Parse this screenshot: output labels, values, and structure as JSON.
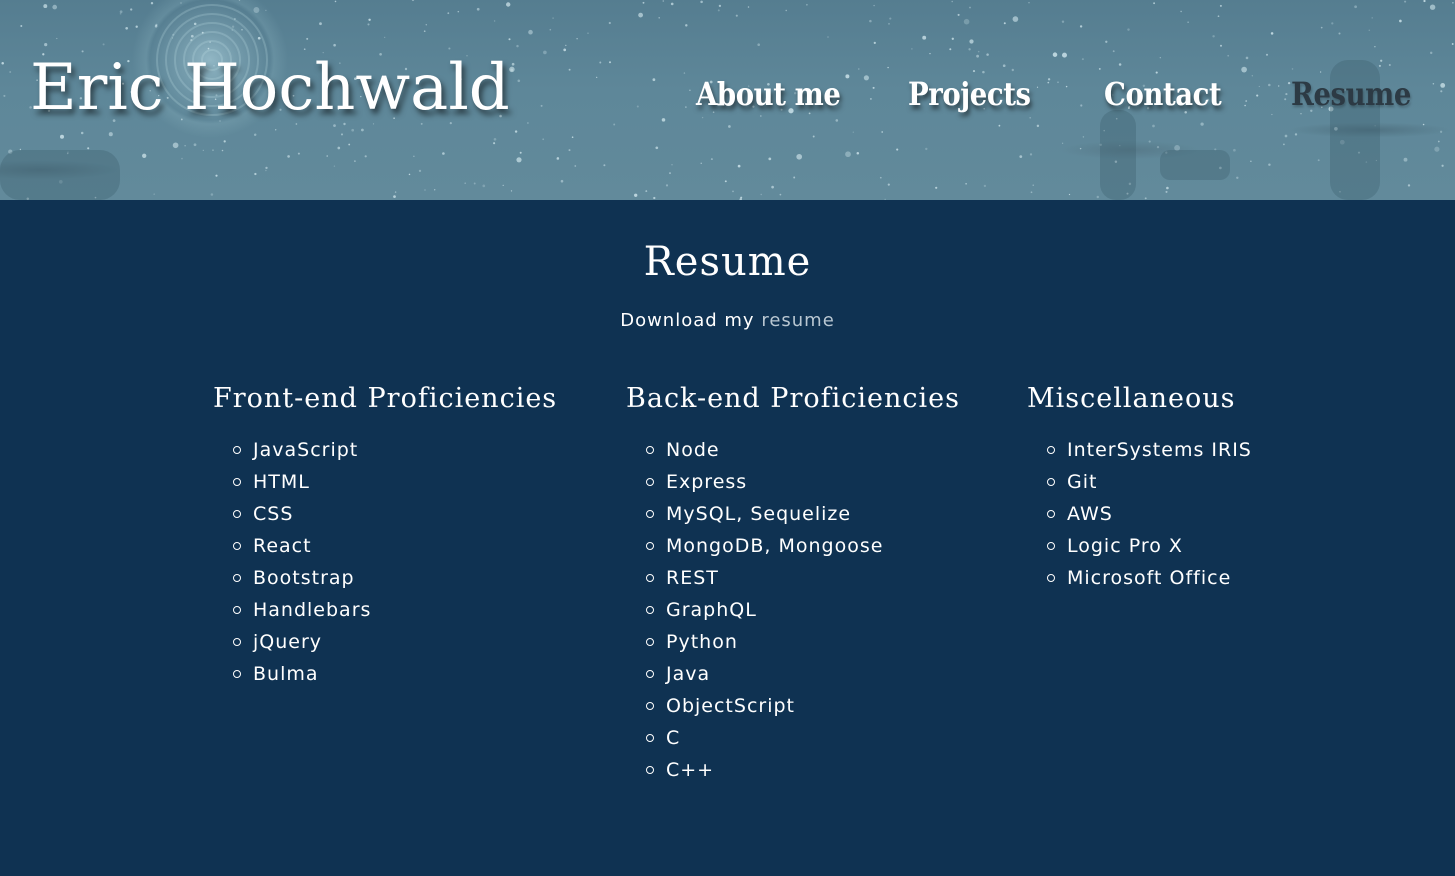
{
  "header": {
    "site_title": "Eric Hochwald",
    "nav": [
      {
        "label": "About me",
        "active": false
      },
      {
        "label": "Projects",
        "active": false
      },
      {
        "label": "Contact",
        "active": false
      },
      {
        "label": "Resume",
        "active": true
      }
    ]
  },
  "main": {
    "title": "Resume",
    "download_prefix": "Download my ",
    "download_link": "resume",
    "columns": [
      {
        "heading": "Front-end Proficiencies",
        "items": [
          "JavaScript",
          "HTML",
          "CSS",
          "React",
          "Bootstrap",
          "Handlebars",
          "jQuery",
          "Bulma"
        ]
      },
      {
        "heading": "Back-end Proficiencies",
        "items": [
          "Node",
          "Express",
          "MySQL, Sequelize",
          "MongoDB, Mongoose",
          "REST",
          "GraphQL",
          "Python",
          "Java",
          "ObjectScript",
          "C",
          "C++"
        ]
      },
      {
        "heading": "Miscellaneous",
        "items": [
          "InterSystems IRIS",
          "Git",
          "AWS",
          "Logic Pro X",
          "Microsoft Office"
        ]
      }
    ]
  },
  "colors": {
    "header_bg": "#5e8799",
    "main_bg": "#0f3252",
    "active_nav": "#2c3a44",
    "link": "#b9c7d2"
  }
}
